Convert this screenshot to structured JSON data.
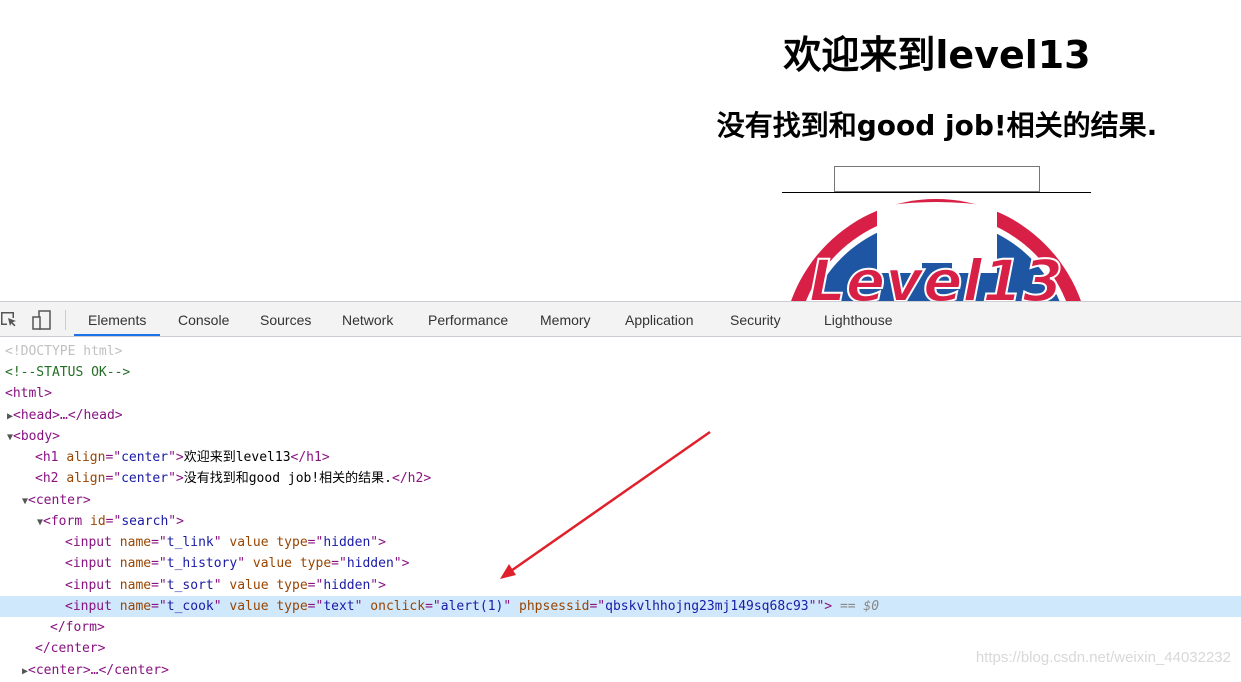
{
  "page": {
    "h1": "欢迎来到level13",
    "h2": "没有找到和good job!相关的结果.",
    "search_value": "",
    "logo_text": "Level13"
  },
  "devtools": {
    "tabs": [
      "Elements",
      "Console",
      "Sources",
      "Network",
      "Performance",
      "Memory",
      "Application",
      "Security",
      "Lighthouse"
    ],
    "active_tab": "Elements",
    "icons": [
      "inspect-element-icon",
      "device-toolbar-icon"
    ],
    "lines": {
      "doctype": "<!DOCTYPE html>",
      "comment": "<!--STATUS OK-->",
      "html": "<html>",
      "head": "<head>…</head>",
      "body": "<body>",
      "h1_text": "欢迎来到level13",
      "h2_text": "没有找到和good job!相关的结果.",
      "form_close": "</form>",
      "center_close": "</center>",
      "center_collapsed": "<center>…</center>",
      "phpsessid": "qbskvlhhojng23mj149sq68c93",
      "selected_suffix": "== $0"
    }
  },
  "watermark": "https://blog.csdn.net/weixin_44032232",
  "colors": {
    "tag": "#881280",
    "attr_name": "#994500",
    "attr_value": "#1a1aa6",
    "selected_row": "#cfe8fc",
    "arrow": "#e0202a",
    "logo_red": "#d81f46",
    "logo_blue": "#1f56a3"
  }
}
